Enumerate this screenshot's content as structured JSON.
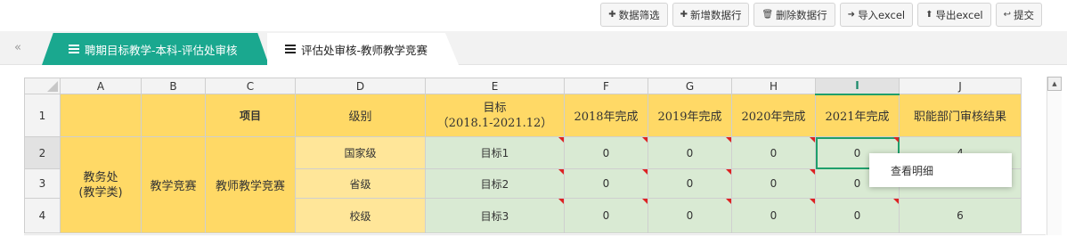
{
  "toolbar": {
    "filter": "数据筛选",
    "add_row": "新增数据行",
    "delete_row": "删除数据行",
    "import": "导入excel",
    "export": "导出excel",
    "submit": "提交",
    "icons": [
      "plus-icon",
      "plus-icon",
      "trash-icon",
      "sign-in-icon",
      "upload-icon",
      "back-icon"
    ]
  },
  "tabs": {
    "collapse_glyph": "«",
    "active": "聘期目标教学-本科-评估处审核",
    "inactive": "评估处审核-教师教学竞赛"
  },
  "sheet": {
    "col_headers": [
      "A",
      "B",
      "C",
      "D",
      "E",
      "F",
      "G",
      "H",
      "I",
      "J"
    ],
    "row_headers": [
      "1",
      "2",
      "3",
      "4"
    ],
    "header_row": {
      "c": "项目",
      "d": "级别",
      "e_line1": "目标",
      "e_line2": "（2018.1-2021.12）",
      "f": "2018年完成",
      "g": "2019年完成",
      "h": "2020年完成",
      "i": "2021年完成",
      "j": "职能部门审核结果"
    },
    "a_merged_line1": "教务处",
    "a_merged_line2": "(教学类)",
    "b_merged": "教学竞赛",
    "c_merged": "教师教学竞赛",
    "rows": [
      {
        "level": "国家级",
        "target": "目标1",
        "y2018": "0",
        "y2019": "0",
        "y2020": "0",
        "y2021": "0",
        "result": "4"
      },
      {
        "level": "省级",
        "target": "目标2",
        "y2018": "0",
        "y2019": "0",
        "y2020": "0",
        "y2021": "0",
        "result": ""
      },
      {
        "level": "校级",
        "target": "目标3",
        "y2018": "0",
        "y2019": "0",
        "y2020": "0",
        "y2021": "0",
        "result": "6"
      }
    ]
  },
  "context_menu": {
    "view_detail": "查看明细"
  },
  "colors": {
    "accent_tab": "#1aa88f",
    "header_yellow": "#ffd966",
    "light_yellow": "#ffe699",
    "cell_green": "#d9ead3",
    "selection": "#1f9f6b",
    "comment_mark": "#dd2222"
  }
}
